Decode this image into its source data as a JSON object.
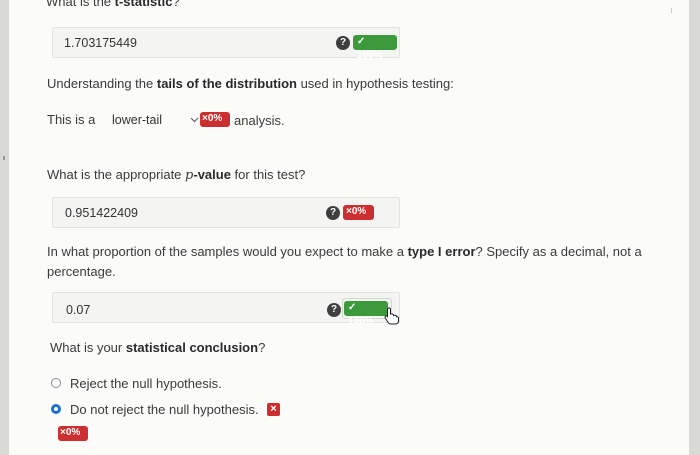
{
  "q1": {
    "heading_pre": "What is the ",
    "heading_bold": "t-statistic",
    "heading_post": "?",
    "answer": "1.703175449",
    "help": "?",
    "score": "✓ 100%"
  },
  "tails": {
    "pre": "Understanding the ",
    "bold": "tails of the distribution",
    "post": " used in hypothesis testing:",
    "sentence_pre": "This is a",
    "select_value": "lower-tail",
    "score": "×0%",
    "sentence_post": "analysis."
  },
  "q_pvalue": {
    "pre": "What is the appropriate ",
    "symbol": "p",
    "bold": "-value",
    "post": " for this test?",
    "answer": "0.951422409",
    "help": "?",
    "score": "×0%"
  },
  "q_type1": {
    "line1_pre": "In what proportion of the samples would you expect to make a ",
    "line1_bold": "type I error",
    "line1_post": "? Specify as a decimal, not a",
    "line2": "percentage.",
    "answer": "0.07",
    "help": "?",
    "score": "✓ 100%"
  },
  "q_conclusion": {
    "pre": "What is your ",
    "bold": "statistical conclusion",
    "post": "?",
    "options": [
      {
        "label": "Reject the null hypothesis.",
        "checked": false
      },
      {
        "label": "Do not reject the null hypothesis.",
        "checked": true
      }
    ],
    "x_mark": "×",
    "score": "×0%"
  },
  "colors": {
    "correct": "#3c9a3c",
    "incorrect": "#cc2f2f",
    "radio_selected": "#1a73c6"
  },
  "icons": {
    "help": "question-circle-icon",
    "dropdown": "chevron-down-icon",
    "check": "check-icon",
    "close": "close-icon",
    "cursor": "hand-pointer-icon"
  }
}
